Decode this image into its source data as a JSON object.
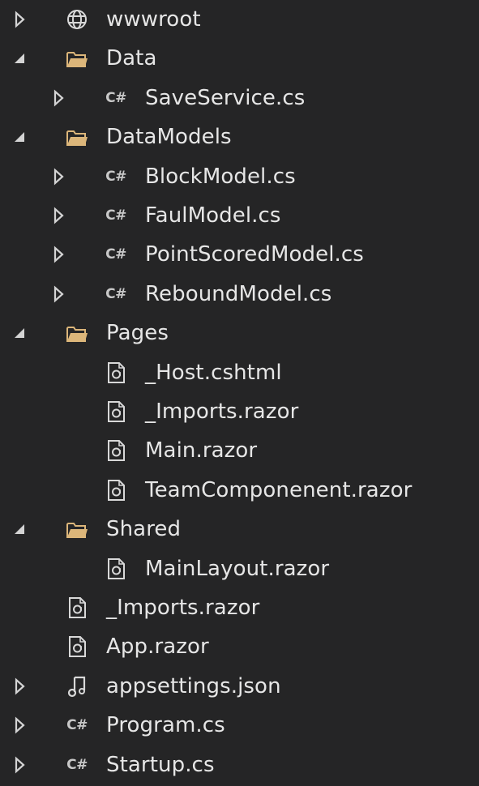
{
  "tree": {
    "items": [
      {
        "label": "wwwroot",
        "icon": "globe-icon",
        "expander": "collapsed",
        "depth": 0
      },
      {
        "label": "Data",
        "icon": "folder-icon",
        "expander": "expanded",
        "depth": 0
      },
      {
        "label": "SaveService.cs",
        "icon": "csharp-file-icon",
        "expander": "collapsed",
        "depth": 1
      },
      {
        "label": "DataModels",
        "icon": "folder-icon",
        "expander": "expanded",
        "depth": 0
      },
      {
        "label": "BlockModel.cs",
        "icon": "csharp-file-icon",
        "expander": "collapsed",
        "depth": 1
      },
      {
        "label": "FaulModel.cs",
        "icon": "csharp-file-icon",
        "expander": "collapsed",
        "depth": 1
      },
      {
        "label": "PointScoredModel.cs",
        "icon": "csharp-file-icon",
        "expander": "collapsed",
        "depth": 1
      },
      {
        "label": "ReboundModel.cs",
        "icon": "csharp-file-icon",
        "expander": "collapsed",
        "depth": 1
      },
      {
        "label": "Pages",
        "icon": "folder-icon",
        "expander": "expanded",
        "depth": 0
      },
      {
        "label": "_Host.cshtml",
        "icon": "razor-file-icon",
        "expander": "none",
        "depth": 1
      },
      {
        "label": "_Imports.razor",
        "icon": "razor-file-icon",
        "expander": "none",
        "depth": 1
      },
      {
        "label": "Main.razor",
        "icon": "razor-file-icon",
        "expander": "none",
        "depth": 1
      },
      {
        "label": "TeamComponenent.razor",
        "icon": "razor-file-icon",
        "expander": "none",
        "depth": 1
      },
      {
        "label": "Shared",
        "icon": "folder-icon",
        "expander": "expanded",
        "depth": 0
      },
      {
        "label": "MainLayout.razor",
        "icon": "razor-file-icon",
        "expander": "none",
        "depth": 1
      },
      {
        "label": "_Imports.razor",
        "icon": "razor-file-icon",
        "expander": "none",
        "depth": 0
      },
      {
        "label": "App.razor",
        "icon": "razor-file-icon",
        "expander": "none",
        "depth": 0
      },
      {
        "label": "appsettings.json",
        "icon": "json-file-icon",
        "expander": "collapsed",
        "depth": 0
      },
      {
        "label": "Program.cs",
        "icon": "csharp-file-icon",
        "expander": "collapsed",
        "depth": 0
      },
      {
        "label": "Startup.cs",
        "icon": "csharp-file-icon",
        "expander": "collapsed",
        "depth": 0
      }
    ],
    "csharp_glyph": "C#"
  },
  "colors": {
    "background": "#252526",
    "text": "#e6e6e6",
    "folder": "#dcb67a",
    "expander": "#d4d4d4"
  }
}
